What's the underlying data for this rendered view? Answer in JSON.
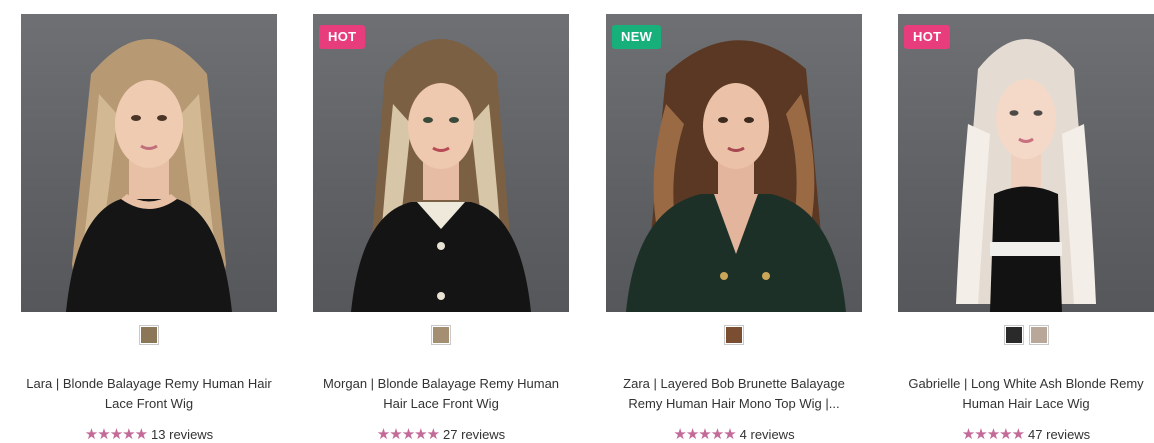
{
  "products": [
    {
      "name": "Lara | Blonde Balayage Remy Human Hair Lace Front Wig",
      "badge": "",
      "swatches": [
        "#8b7658"
      ],
      "rating": 5,
      "reviews": "13 reviews",
      "hair_colors": [
        "#b79a74",
        "#d2b993"
      ],
      "outfit_color": "#151515"
    },
    {
      "name": "Morgan | Blonde Balayage Remy Human Hair Lace Front Wig",
      "badge": "HOT",
      "swatches": [
        "#a58f73"
      ],
      "rating": 5,
      "reviews": "27 reviews",
      "hair_colors": [
        "#7b6043",
        "#d7c6a8"
      ],
      "outfit_color": "#141414"
    },
    {
      "name": "Zara | Layered Bob Brunette Balayage Remy Human Hair Mono Top Wig |...",
      "badge": "NEW",
      "swatches": [
        "#7b4e32"
      ],
      "rating": 5,
      "reviews": "4 reviews",
      "hair_colors": [
        "#5b3823",
        "#9a6a45"
      ],
      "outfit_color": "#1d3028"
    },
    {
      "name": "Gabrielle | Long White Ash Blonde Remy Human Hair Lace Wig",
      "badge": "HOT",
      "swatches": [
        "#2a2a2a",
        "#b9a89a"
      ],
      "rating": 5,
      "reviews": "47 reviews",
      "hair_colors": [
        "#e4dcd2",
        "#f3eee8"
      ],
      "outfit_color": "#121212"
    }
  ],
  "badge_colors": {
    "HOT": "#e83d7d",
    "NEW": "#17b07a"
  },
  "star_color": "#c36a98",
  "star_glyph": "★★★★★"
}
